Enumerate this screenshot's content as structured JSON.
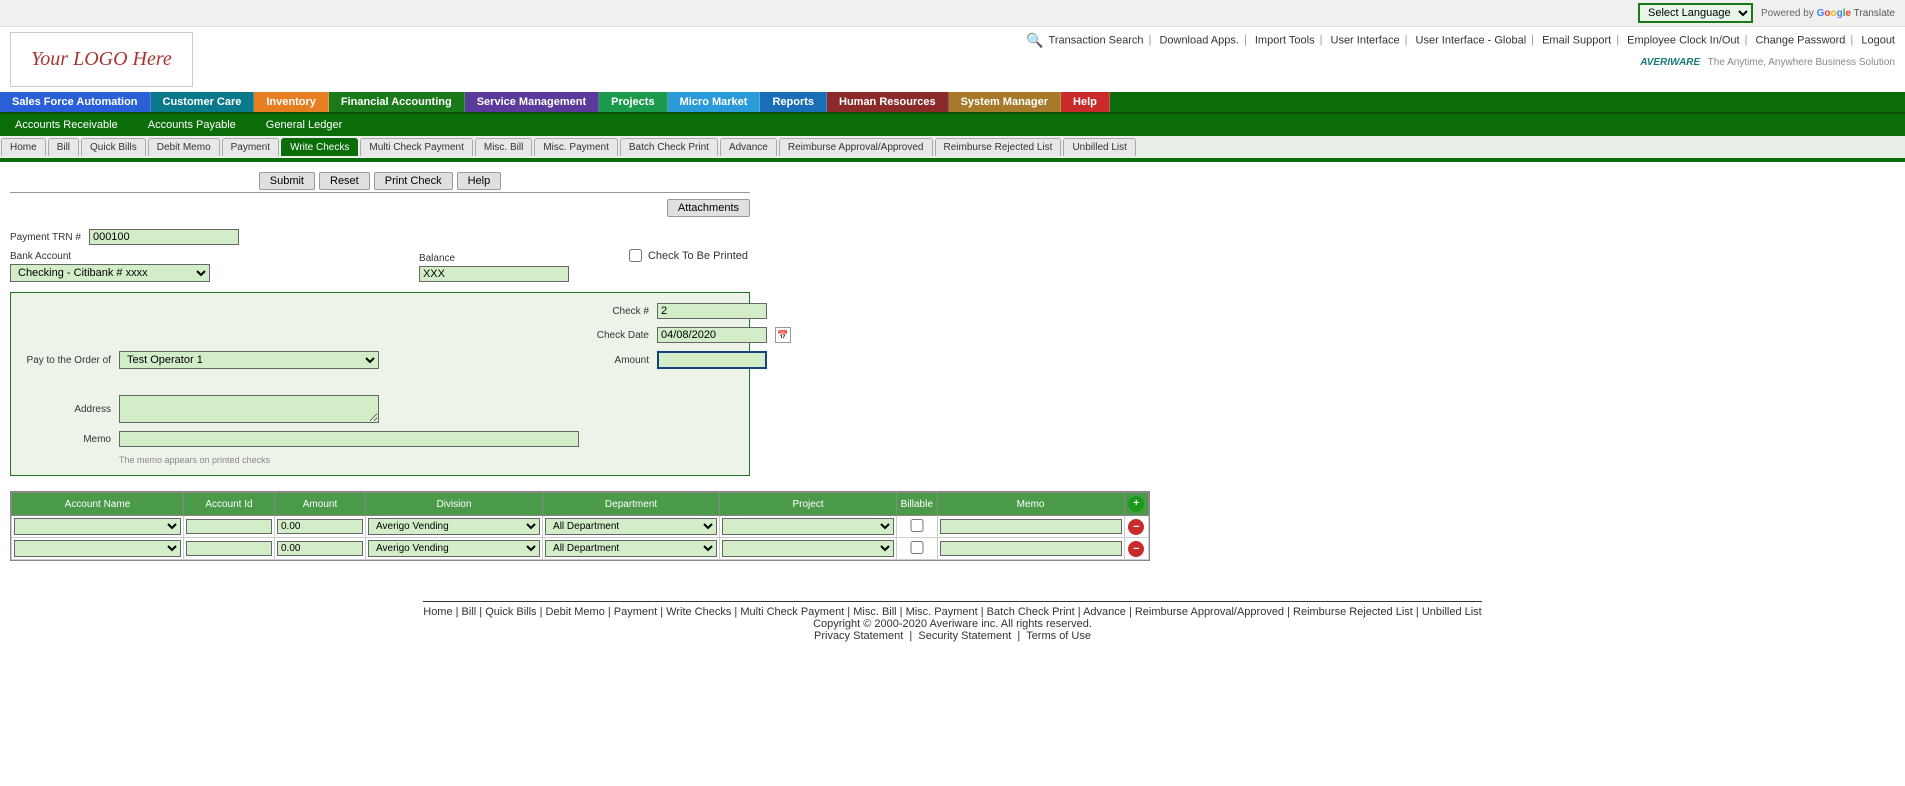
{
  "top": {
    "language_selected": "Select Language",
    "powered_by": "Powered by",
    "google": "Google",
    "translate": "Translate"
  },
  "logo": "Your LOGO Here",
  "header_links": {
    "transaction_search": "Transaction Search",
    "download_apps": "Download Apps.",
    "import_tools": "Import Tools",
    "user_interface": "User Interface",
    "user_interface_global": "User Interface - Global",
    "email_support": "Email Support",
    "employee_clock": "Employee Clock In/Out",
    "change_password": "Change Password",
    "logout": "Logout"
  },
  "brand": "AVERIWARE",
  "tagline": "The Anytime, Anywhere Business Solution",
  "main_nav": {
    "sfa": "Sales Force Automation",
    "customer_care": "Customer Care",
    "inventory": "Inventory",
    "financial": "Financial Accounting",
    "service": "Service Management",
    "projects": "Projects",
    "micro_market": "Micro Market",
    "reports": "Reports",
    "hr": "Human Resources",
    "system_manager": "System Manager",
    "help": "Help"
  },
  "sub_nav": {
    "ar": "Accounts Receivable",
    "ap": "Accounts Payable",
    "gl": "General Ledger"
  },
  "sub_nav2": {
    "home": "Home",
    "bill": "Bill",
    "quick_bills": "Quick Bills",
    "debit_memo": "Debit Memo",
    "payment": "Payment",
    "write_checks": "Write Checks",
    "multi_check": "Multi Check Payment",
    "misc_bill": "Misc. Bill",
    "misc_payment": "Misc. Payment",
    "batch_check": "Batch Check Print",
    "advance": "Advance",
    "reimburse_approval": "Reimburse Approval/Approved",
    "reimburse_rejected": "Reimburse Rejected List",
    "unbilled_list": "Unbilled List"
  },
  "actions": {
    "submit": "Submit",
    "reset": "Reset",
    "print_check": "Print Check",
    "help": "Help",
    "attachments": "Attachments"
  },
  "form": {
    "payment_trn_label": "Payment TRN #",
    "payment_trn_value": "000100",
    "bank_account_label": "Bank Account",
    "bank_account_value": "Checking - Citibank # xxxx",
    "balance_label": "Balance",
    "balance_value": "XXX",
    "check_to_be_printed": "Check To Be Printed",
    "check_num_label": "Check #",
    "check_num_value": "2",
    "check_date_label": "Check Date",
    "check_date_value": "04/08/2020",
    "amount_label": "Amount",
    "amount_value": "",
    "pay_order_label": "Pay to the Order of",
    "pay_order_value": "Test Operator 1",
    "address_label": "Address",
    "address_value": "",
    "memo_label": "Memo",
    "memo_value": "",
    "memo_note": "The memo appears on printed checks"
  },
  "grid": {
    "headers": {
      "account_name": "Account Name",
      "account_id": "Account Id",
      "amount": "Amount",
      "division": "Division",
      "department": "Department",
      "project": "Project",
      "billable": "Billable",
      "memo": "Memo"
    },
    "rows": [
      {
        "account_name": "",
        "account_id": "",
        "amount": "0.00",
        "division": "Averigo Vending",
        "department": "All Department",
        "project": "",
        "billable": false,
        "memo": ""
      },
      {
        "account_name": "",
        "account_id": "",
        "amount": "0.00",
        "division": "Averigo Vending",
        "department": "All Department",
        "project": "",
        "billable": false,
        "memo": ""
      }
    ]
  },
  "footer": {
    "links": "Home | Bill | Quick Bills | Debit Memo | Payment | Write Checks | Multi Check Payment | Misc. Bill | Misc. Payment | Batch Check Print | Advance | Reimburse Approval/Approved | Reimburse Rejected List | Unbilled List",
    "copyright": "Copyright © 2000-2020 Averiware inc. All rights reserved.",
    "legal_privacy": "Privacy Statement",
    "legal_security": "Security Statement",
    "legal_terms": "Terms of Use"
  }
}
